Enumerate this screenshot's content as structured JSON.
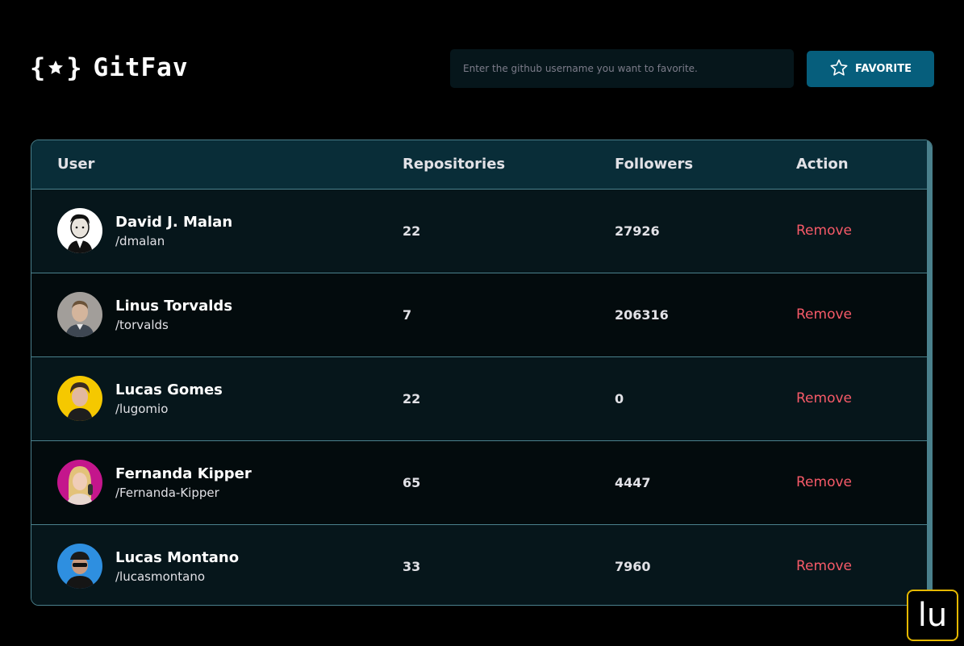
{
  "app": {
    "title": "GitFav"
  },
  "search": {
    "placeholder": "Enter the github username you want to favorite."
  },
  "favorite_button": {
    "label": "FAVORITE",
    "icon": "star-outline-icon"
  },
  "table": {
    "headers": {
      "user": "User",
      "repositories": "Repositories",
      "followers": "Followers",
      "action": "Action"
    },
    "rows": [
      {
        "name": "David J. Malan",
        "login": "/dmalan",
        "repositories": "22",
        "followers": "27926",
        "action": "Remove",
        "avatar": "avatar-dmalan"
      },
      {
        "name": "Linus Torvalds",
        "login": "/torvalds",
        "repositories": "7",
        "followers": "206316",
        "action": "Remove",
        "avatar": "avatar-torvalds"
      },
      {
        "name": "Lucas Gomes",
        "login": "/lugomio",
        "repositories": "22",
        "followers": "0",
        "action": "Remove",
        "avatar": "avatar-lugomio"
      },
      {
        "name": "Fernanda Kipper",
        "login": "/Fernanda-Kipper",
        "repositories": "65",
        "followers": "4447",
        "action": "Remove",
        "avatar": "avatar-fernanda-kipper"
      },
      {
        "name": "Lucas Montano",
        "login": "/lucasmontano",
        "repositories": "33",
        "followers": "7960",
        "action": "Remove",
        "avatar": "avatar-lucasmontano"
      }
    ]
  },
  "badge": {
    "text": "lu"
  },
  "colors": {
    "background": "#000000",
    "header_row": "#092D38",
    "row_odd": "#06161B",
    "row_even": "#030B0D",
    "border": "#4A808C",
    "button": "#065E7C",
    "remove": "#F75A68",
    "badge_border": "#E5B800"
  }
}
